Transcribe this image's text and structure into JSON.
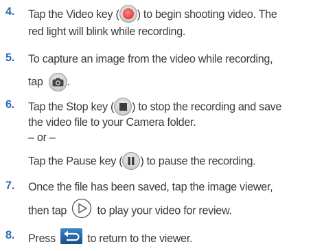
{
  "steps": [
    {
      "num": "4.",
      "lines": [
        "Tap the Video key (",
        ") to begin shooting video. The",
        "red light will blink while recording."
      ]
    },
    {
      "num": "5.",
      "lines": [
        "To capture an image from the video while recording,",
        "tap",
        "."
      ]
    },
    {
      "num": "6.",
      "lines": [
        "Tap the Stop key (",
        ") to stop the recording and save",
        "the video file to your Camera folder.",
        "– or –",
        "Tap the Pause key (",
        ") to pause the recording."
      ]
    },
    {
      "num": "7.",
      "lines": [
        "Once the file has been saved, tap the image viewer,",
        "then tap",
        "to play your video for review."
      ]
    },
    {
      "num": "8.",
      "lines": [
        "Press",
        "to return to the viewer."
      ]
    }
  ],
  "icons": {
    "video": "video-record-icon",
    "camera": "camera-icon",
    "stop": "stop-icon",
    "pause": "pause-icon",
    "play": "play-icon",
    "back": "back-icon"
  },
  "colors": {
    "number": "#2b6cb0",
    "record": "#e8474a",
    "back": "#1f6aa8"
  }
}
